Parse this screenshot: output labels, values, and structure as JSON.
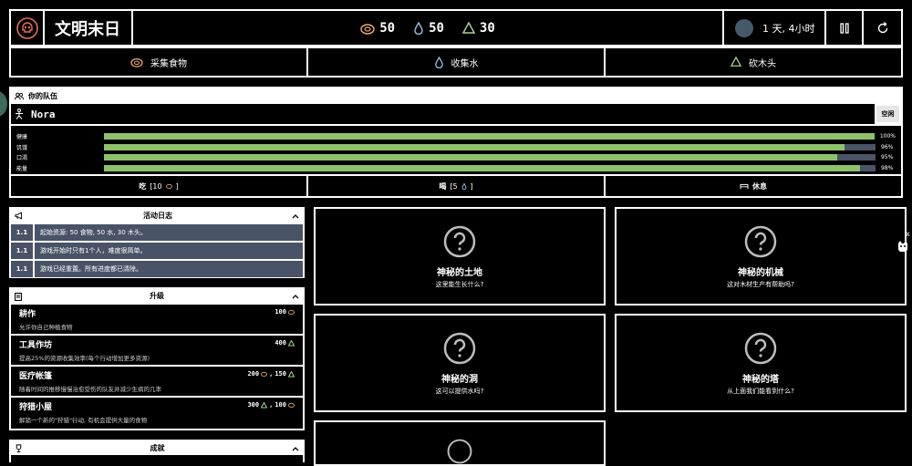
{
  "header": {
    "title": "文明末日",
    "resources": [
      {
        "icon": "food-icon",
        "value": "50"
      },
      {
        "icon": "water-icon",
        "value": "50"
      },
      {
        "icon": "wood-icon",
        "value": "30"
      }
    ],
    "time": "1 天, 4小时"
  },
  "actions": [
    {
      "icon": "food-icon",
      "label": "采集食物"
    },
    {
      "icon": "water-icon",
      "label": "收集水"
    },
    {
      "icon": "wood-icon",
      "label": "砍木头"
    }
  ],
  "team": {
    "title": "你的队伍",
    "member": {
      "name": "Nora",
      "status": "空闲"
    },
    "stats": [
      {
        "label": "健康",
        "value": 100,
        "text": "100%"
      },
      {
        "label": "饥饿",
        "value": 96,
        "text": "96%"
      },
      {
        "label": "口渴",
        "value": 95,
        "text": "95%"
      },
      {
        "label": "能量",
        "value": 98,
        "text": "98%"
      }
    ],
    "buttons": {
      "eat": "吃",
      "eat_cost": "[10",
      "drink": "喝",
      "drink_cost": "[5",
      "rest": "休息"
    }
  },
  "log": {
    "title": "活动日志",
    "entries": [
      {
        "time": "1.1",
        "text": "起始资源: 50 食物, 50 水, 30 木头。"
      },
      {
        "time": "1.1",
        "text": "游戏开始时只有1个人，难度很简单。"
      },
      {
        "time": "1.1",
        "text": "游戏已经重置。所有进度都已清除。"
      }
    ]
  },
  "upgrades": {
    "title": "升级",
    "items": [
      {
        "name": "耕作",
        "desc": "允许你自己种植食物",
        "cost": "100"
      },
      {
        "name": "工具作坊",
        "desc": "提高25%的资源收集效率(每个行动增加更多资源)",
        "cost": "400"
      },
      {
        "name": "医疗帐篷",
        "desc": "随着时间的推移慢慢治愈受伤的队友并减少生病的几率",
        "cost1": "200",
        "cost2": "150"
      },
      {
        "name": "狩猎小屋",
        "desc": "解锁一个新的\"狩猎\"行动, 有机会提供大量的食物",
        "cost1": "300",
        "cost2": "100"
      }
    ]
  },
  "achievements": {
    "title": "成就"
  },
  "mysteries": [
    {
      "title": "神秘的土地",
      "desc": "这里能生长什么?"
    },
    {
      "title": "神秘的机械",
      "desc": "这对木材生产有帮助吗?"
    },
    {
      "title": "神秘的洞",
      "desc": "这可以提供水吗?"
    },
    {
      "title": "神秘的塔",
      "desc": "从上面我们能看到什么?"
    }
  ],
  "colors": {
    "accent": "#e76f51",
    "food": "#e9a46a",
    "water": "#8fb8de",
    "wood": "#a9d18e",
    "bar": "#8dc26b",
    "track": "#4a5466",
    "log_bg": "#495367"
  }
}
